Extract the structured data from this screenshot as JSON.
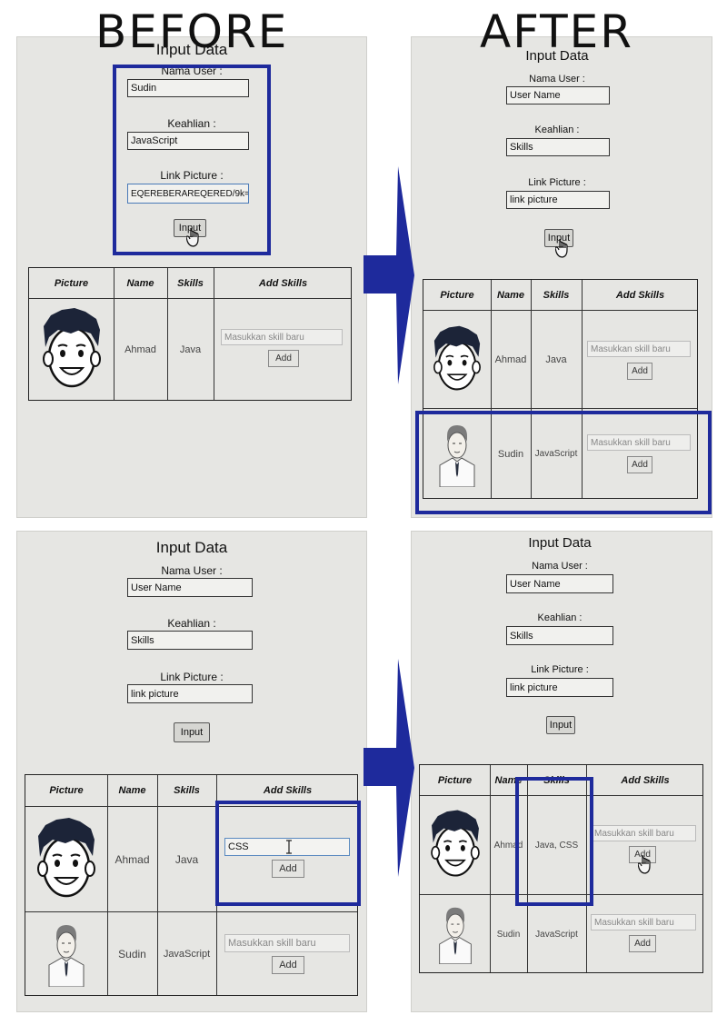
{
  "labels": {
    "before": "BEFORE",
    "after": "AFTER"
  },
  "form": {
    "title": "Input Data",
    "name_label": "Nama User :",
    "skill_label": "Keahlian :",
    "picture_label": "Link Picture :",
    "name_placeholder": "User Name",
    "skill_placeholder": "Skills",
    "picture_placeholder": "link picture",
    "input_button": "Input"
  },
  "before_form_values": {
    "name": "Sudin",
    "skill": "JavaScript",
    "picture": "EQEREBERAREQERED/9k="
  },
  "table": {
    "headers": [
      "Picture",
      "Name",
      "Skills",
      "Add Skills"
    ],
    "skill_placeholder": "Masukkan skill baru",
    "add_button": "Add"
  },
  "rows": {
    "ahmad": {
      "name": "Ahmad",
      "skills": "Java",
      "skills_after": "Java, CSS",
      "typed_skill": "CSS"
    },
    "sudin": {
      "name": "Sudin",
      "skills": "JavaScript"
    }
  },
  "colors": {
    "highlight": "#1e2a9c",
    "panel_bg": "#e6e6e3"
  },
  "icons": [
    "arrow-right-icon",
    "hand-cursor-icon",
    "text-cursor-icon",
    "cartoon-face-avatar",
    "sketch-man-avatar"
  ]
}
